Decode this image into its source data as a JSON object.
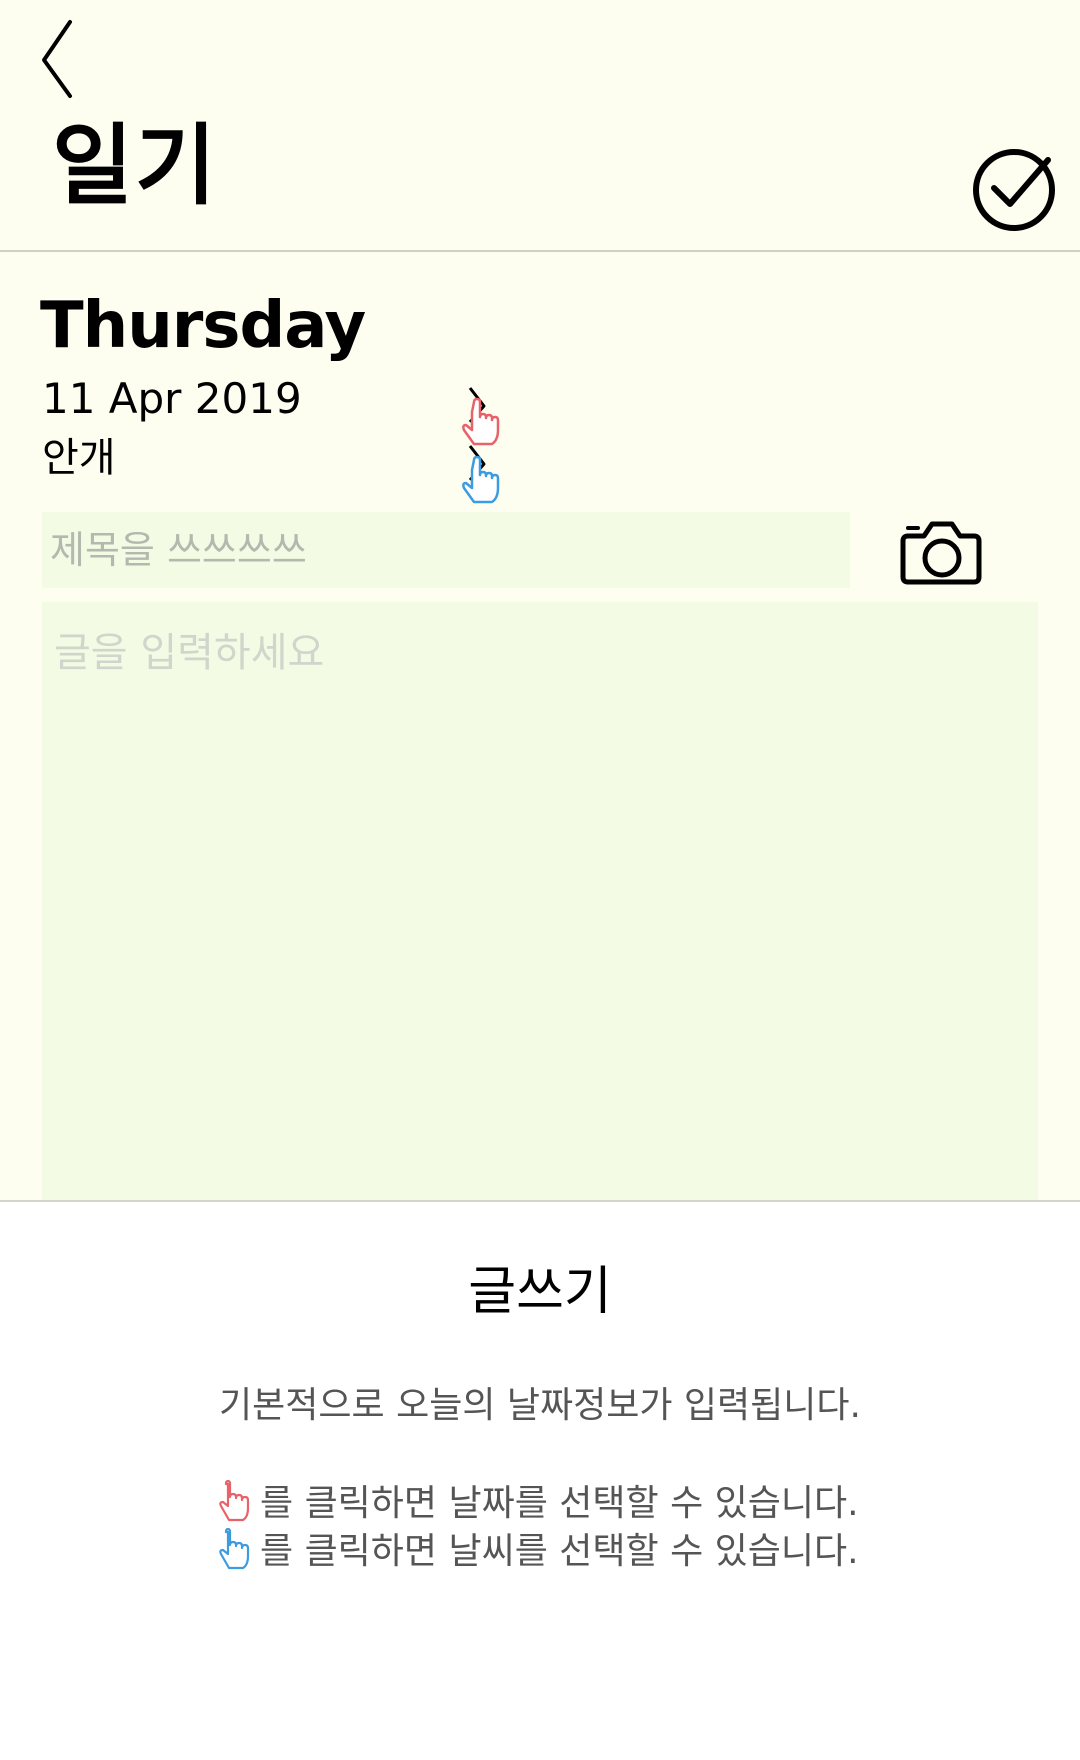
{
  "header": {
    "title": "일기",
    "back_icon": "chevron-left-icon",
    "confirm_icon": "check-circle-icon"
  },
  "entry": {
    "day_name": "Thursday",
    "date": "11 Apr 2019",
    "weather": "안개",
    "title_placeholder": "제목을 쓰쓰쓰쓰",
    "body_placeholder": "글을 입력하세요",
    "camera_icon": "camera-icon",
    "date_select_icon": "pointing-hand-icon",
    "weather_select_icon": "pointing-hand-icon"
  },
  "guide": {
    "title": "글쓰기",
    "line1": "기본적으로 오늘의 날짜정보가 입력됩니다.",
    "line2": "를 클릭하면 날짜를 선택할 수 있습니다.",
    "line3": "를 클릭하면 날씨를 선택할 수 있습니다."
  },
  "colors": {
    "background": "#fdfef0",
    "input_background": "#f4fbe4",
    "date_hand": "#e8626a",
    "weather_hand": "#3d9be0",
    "guide_text": "#555555"
  }
}
